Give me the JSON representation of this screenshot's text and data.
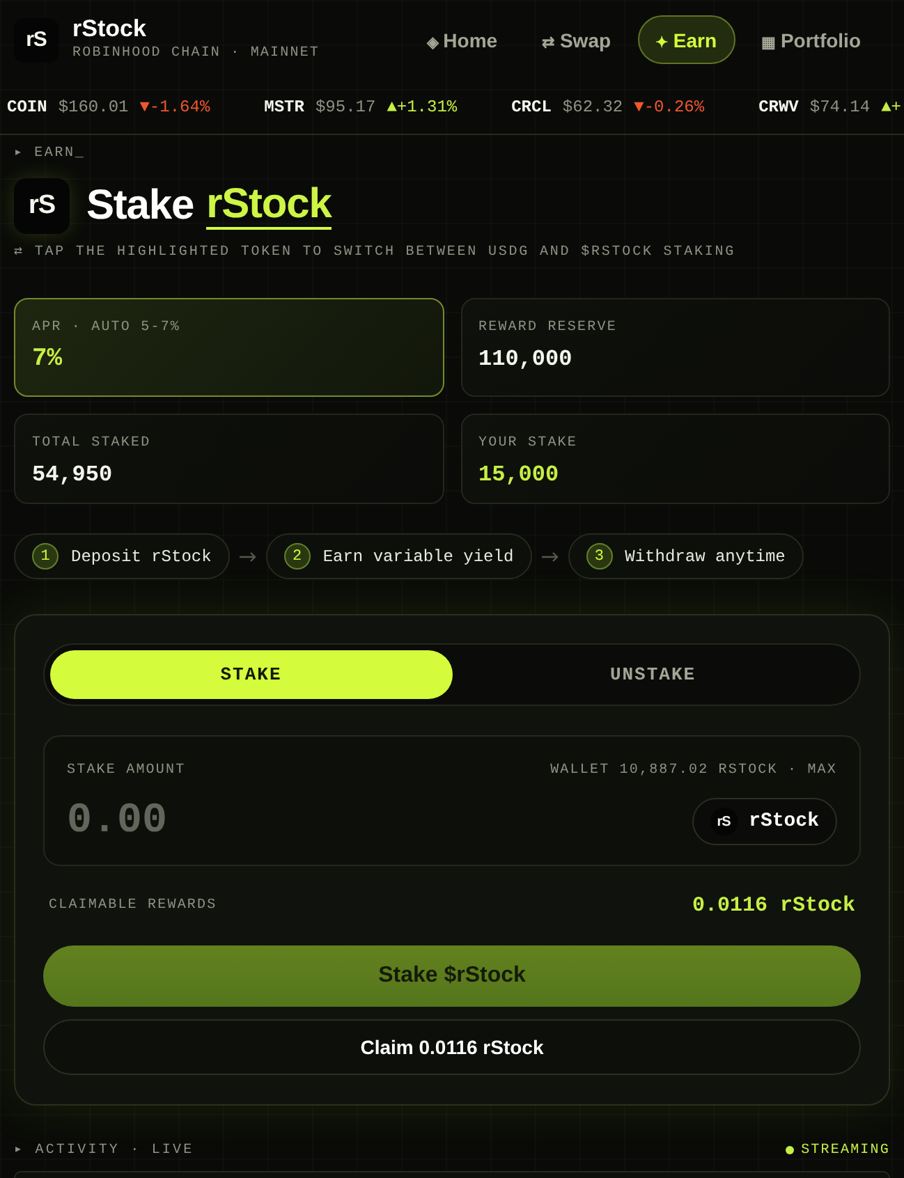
{
  "header": {
    "logo_text": "rS",
    "brand": "rStock",
    "network": "ROBINHOOD CHAIN · MAINNET",
    "nav": [
      {
        "icon": "◈",
        "label": "Home",
        "selected": false
      },
      {
        "icon": "⇄",
        "label": "Swap",
        "selected": false
      },
      {
        "icon": "✦",
        "label": "Earn",
        "selected": true
      },
      {
        "icon": "▦",
        "label": "Portfolio",
        "selected": false
      }
    ]
  },
  "ticker": [
    {
      "symbol": "COIN",
      "price": "$160.01",
      "change": "▼-1.64%",
      "rising": false
    },
    {
      "symbol": "MSTR",
      "price": "$95.17",
      "change": "▲+1.31%",
      "rising": true
    },
    {
      "symbol": "CRCL",
      "price": "$62.32",
      "change": "▼-0.26%",
      "rising": false
    },
    {
      "symbol": "CRWV",
      "price": "$74.14",
      "change": "▲+",
      "rising": true
    }
  ],
  "breadcrumb": "▸ EARN_",
  "title": {
    "logo_text": "rS",
    "lead": "Stake",
    "token": "rStock"
  },
  "hint": "⇄ TAP THE HIGHLIGHTED TOKEN TO SWITCH BETWEEN USDG AND $RSTOCK STAKING",
  "stats": [
    {
      "label": "APR · AUTO 5-7%",
      "value": "7%",
      "highlighted": true,
      "accent": true
    },
    {
      "label": "REWARD RESERVE",
      "value": "110,000",
      "highlighted": false,
      "accent": false
    },
    {
      "label": "TOTAL STAKED",
      "value": "54,950",
      "highlighted": false,
      "accent": false
    },
    {
      "label": "YOUR STAKE",
      "value": "15,000",
      "highlighted": false,
      "accent": true
    }
  ],
  "steps": [
    {
      "number": "1",
      "label": "Deposit rStock"
    },
    {
      "number": "2",
      "label": "Earn variable yield"
    },
    {
      "number": "3",
      "label": "Withdraw anytime"
    }
  ],
  "panel": {
    "tabs": [
      {
        "label": "STAKE",
        "selected": true
      },
      {
        "label": "UNSTAKE",
        "selected": false
      }
    ],
    "amount": {
      "label": "STAKE AMOUNT",
      "wallet": "WALLET 10,887.02 RSTOCK · MAX",
      "placeholder": "0.00",
      "token_logo": "rS",
      "token": "rStock"
    },
    "rewards": {
      "label": "CLAIMABLE REWARDS",
      "value": "0.0116 rStock"
    },
    "buttons": [
      {
        "label": "Stake $rStock",
        "kind": "primary",
        "disabled": true
      },
      {
        "label": "Claim 0.0116 rStock",
        "kind": "secondary",
        "disabled": false
      }
    ]
  },
  "activity": {
    "label": "▸ ACTIVITY · LIVE",
    "status": "STREAMING"
  }
}
